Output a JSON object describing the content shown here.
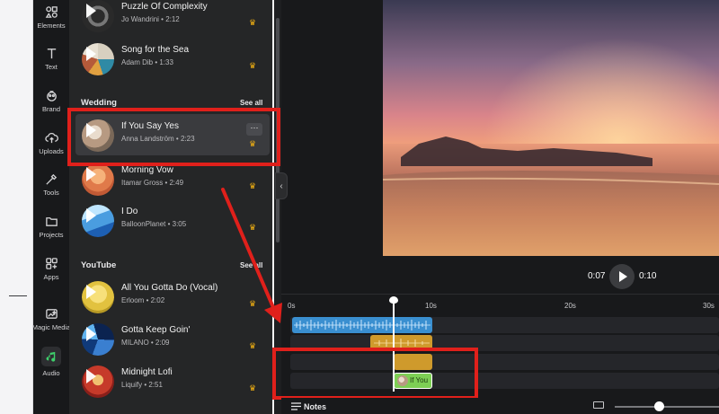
{
  "rail": {
    "items": [
      {
        "label": "Elements"
      },
      {
        "label": "Text"
      },
      {
        "label": "Brand"
      },
      {
        "label": "Uploads"
      },
      {
        "label": "Tools"
      },
      {
        "label": "Projects"
      },
      {
        "label": "Apps"
      },
      {
        "label": "Magic Media"
      },
      {
        "label": "Audio"
      }
    ]
  },
  "sections": {
    "wedding": {
      "title": "Wedding",
      "see_all": "See all"
    },
    "youtube": {
      "title": "YouTube",
      "see_all": "See all"
    }
  },
  "tracks": [
    {
      "title": "Puzzle Of Complexity",
      "subtitle": "Jo Wandrini • 2:12"
    },
    {
      "title": "Song for the Sea",
      "subtitle": "Adam Dib • 1:33"
    },
    {
      "title": "If You Say Yes",
      "subtitle": "Anna Landström • 2:23"
    },
    {
      "title": "Morning Vow",
      "subtitle": "Itamar Gross • 2:49"
    },
    {
      "title": "I Do",
      "subtitle": "BalloonPlanet • 3:05"
    },
    {
      "title": "All You Gotta Do (Vocal)",
      "subtitle": "Erloom • 2:02"
    },
    {
      "title": "Gotta Keep Goin'",
      "subtitle": "MILANO • 2:09"
    },
    {
      "title": "Midnight Lofi",
      "subtitle": "Liquify • 2:51"
    }
  ],
  "player": {
    "current_time": "0:07",
    "total_time": "0:10"
  },
  "timeline": {
    "ticks": [
      "0s",
      "10s",
      "20s",
      "30s"
    ],
    "clip_label": "If You"
  },
  "bottom": {
    "notes_label": "Notes"
  },
  "colors": {
    "premium_crown": "#f5b312",
    "highlight": "#e0201b",
    "audio_clip": "#3a8fd0",
    "gold_clip": "#cf9a2c",
    "green_clip": "#7dcf54"
  }
}
